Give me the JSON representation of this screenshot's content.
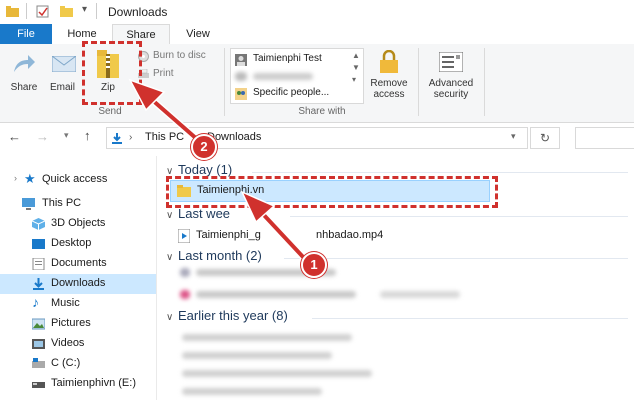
{
  "window": {
    "title": "Downloads"
  },
  "tabs": {
    "file": "File",
    "home": "Home",
    "share": "Share",
    "view": "View"
  },
  "ribbon": {
    "share": "Share",
    "email": "Email",
    "zip": "Zip",
    "burn": "Burn to disc",
    "print": "Print",
    "send_group": "Send",
    "contact_1": "Taimienphi Test",
    "specific_people": "Specific people...",
    "share_with_group": "Share with",
    "remove_access_1": "Remove",
    "remove_access_2": "access",
    "advanced_security_1": "Advanced",
    "advanced_security_2": "security"
  },
  "navbar": {
    "path_1": "This PC",
    "path_sep": ">",
    "path_2": "Downloads"
  },
  "sidebar": {
    "items": [
      {
        "label": "Quick access",
        "icon": "star-icon"
      },
      {
        "label": "This PC",
        "icon": "computer-icon"
      },
      {
        "label": "3D Objects",
        "icon": "cube-icon"
      },
      {
        "label": "Desktop",
        "icon": "desktop-icon"
      },
      {
        "label": "Documents",
        "icon": "document-icon"
      },
      {
        "label": "Downloads",
        "icon": "download-icon"
      },
      {
        "label": "Music",
        "icon": "music-icon"
      },
      {
        "label": "Pictures",
        "icon": "picture-icon"
      },
      {
        "label": "Videos",
        "icon": "video-icon"
      },
      {
        "label": "C (C:)",
        "icon": "drive-icon"
      },
      {
        "label": "Taimienphivn (E:)",
        "icon": "usb-drive-icon"
      }
    ]
  },
  "content": {
    "groups": [
      {
        "label": "Today (1)"
      },
      {
        "label": "Last wee"
      },
      {
        "label": "Last month (2)"
      },
      {
        "label": "Earlier this year (8)"
      }
    ],
    "folder_name": "Taimienphi.vn",
    "video_name": "Taimienphi_g",
    "video_name_tail": "nhbadao.mp4"
  },
  "annotations": {
    "badge_1": "1",
    "badge_2": "2"
  },
  "colors": {
    "accent": "#1979ca",
    "annotation": "#d0312d",
    "selection": "#cce8ff"
  }
}
